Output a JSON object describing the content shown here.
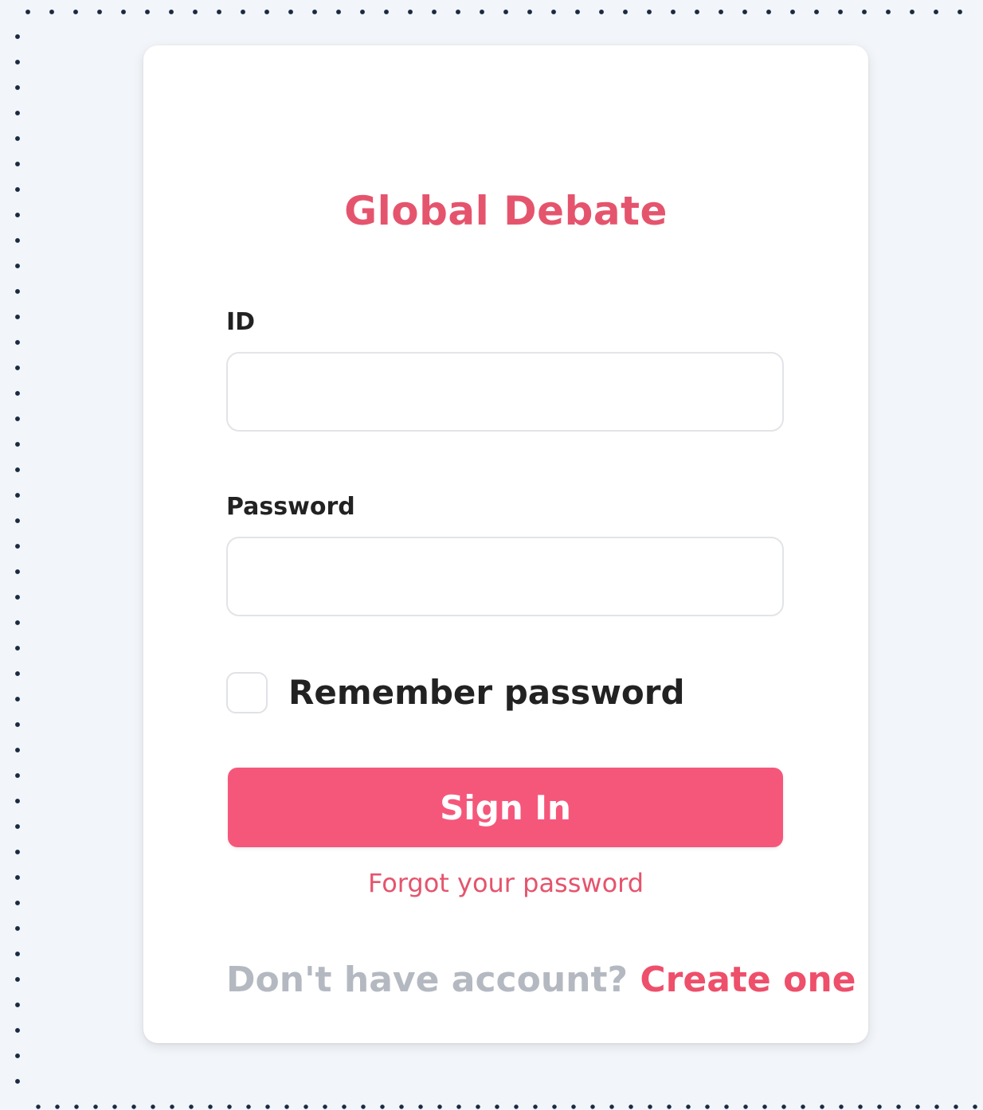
{
  "app": {
    "title": "Global Debate"
  },
  "form": {
    "id_label": "ID",
    "id_value": "",
    "password_label": "Password",
    "password_value": "",
    "remember_label": "Remember password",
    "remember_checked": false,
    "signin_label": "Sign In",
    "forgot_label": "Forgot your password",
    "signup_question": "Don't have account?",
    "signup_link": "Create one"
  },
  "colors": {
    "accent": "#f5577b",
    "title": "#e5546d",
    "muted_text": "#b4b9c1",
    "page_background": "#f2f5f9"
  }
}
